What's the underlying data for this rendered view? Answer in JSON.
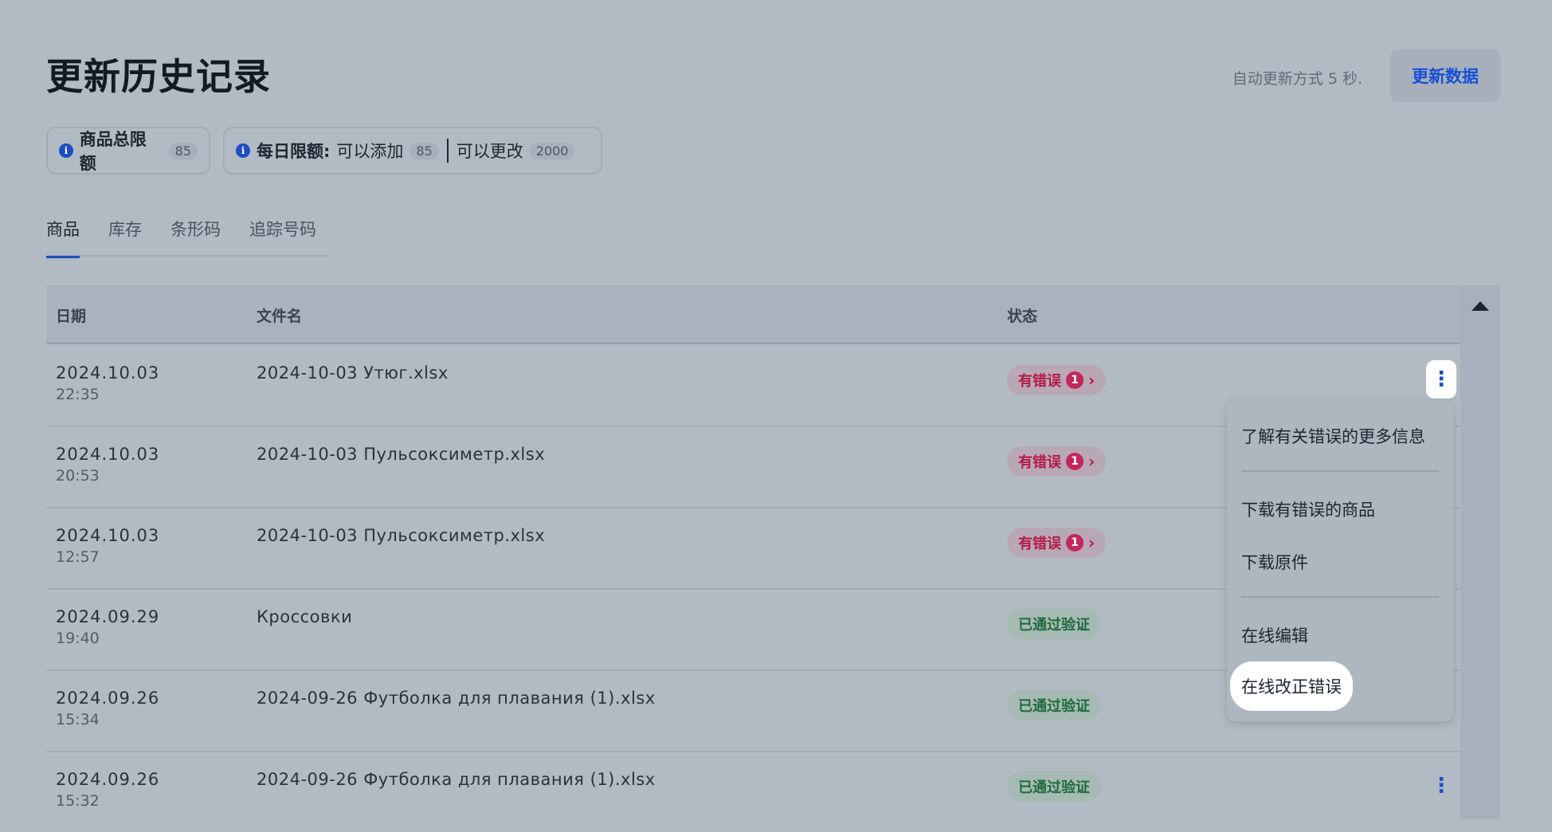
{
  "header": {
    "title": "更新历史记录",
    "auto_refresh": "自动更新方式 5 秒.",
    "refresh_button": "更新数据"
  },
  "limits": {
    "total_label": "商品总限额",
    "total_count": "85",
    "daily_label": "每日限额:",
    "add_label": "可以添加",
    "add_count": "85",
    "change_label": "可以更改",
    "change_count": "2000"
  },
  "tabs": [
    {
      "label": "商品",
      "active": true
    },
    {
      "label": "库存",
      "active": false
    },
    {
      "label": "条形码",
      "active": false
    },
    {
      "label": "追踪号码",
      "active": false
    }
  ],
  "table": {
    "columns": [
      "日期",
      "文件名",
      "状态"
    ],
    "rows": [
      {
        "date": "2024.10.03",
        "time": "22:35",
        "file": "2024-10-03 Утюг.xlsx",
        "status": "有错误",
        "status_type": "error",
        "errors": "1"
      },
      {
        "date": "2024.10.03",
        "time": "20:53",
        "file": "2024-10-03 Пульсоксиметр.xlsx",
        "status": "有错误",
        "status_type": "error",
        "errors": "1"
      },
      {
        "date": "2024.10.03",
        "time": "12:57",
        "file": "2024-10-03 Пульсоксиметр.xlsx",
        "status": "有错误",
        "status_type": "error",
        "errors": "1"
      },
      {
        "date": "2024.09.29",
        "time": "19:40",
        "file": "Кроссовки",
        "status": "已通过验证",
        "status_type": "ok"
      },
      {
        "date": "2024.09.26",
        "time": "15:34",
        "file": "2024-09-26 Футболка для плавания (1).xlsx",
        "status": "已通过验证",
        "status_type": "ok"
      },
      {
        "date": "2024.09.26",
        "time": "15:32",
        "file": "2024-09-26 Футболка для плавания (1).xlsx",
        "status": "已通过验证",
        "status_type": "ok"
      }
    ]
  },
  "menu": {
    "items": [
      "了解有关错误的更多信息",
      "下载有错误的商品",
      "下载原件",
      "在线编辑",
      "在线改正错误"
    ]
  },
  "icons": {
    "info": "info-icon",
    "kebab": "more-vertical-icon",
    "chevron": "chevron-right-icon",
    "scroll_up": "caret-up-icon"
  },
  "colors": {
    "accent": "#1b4fc2",
    "error": "#b41a47",
    "success": "#1f6b3c"
  }
}
